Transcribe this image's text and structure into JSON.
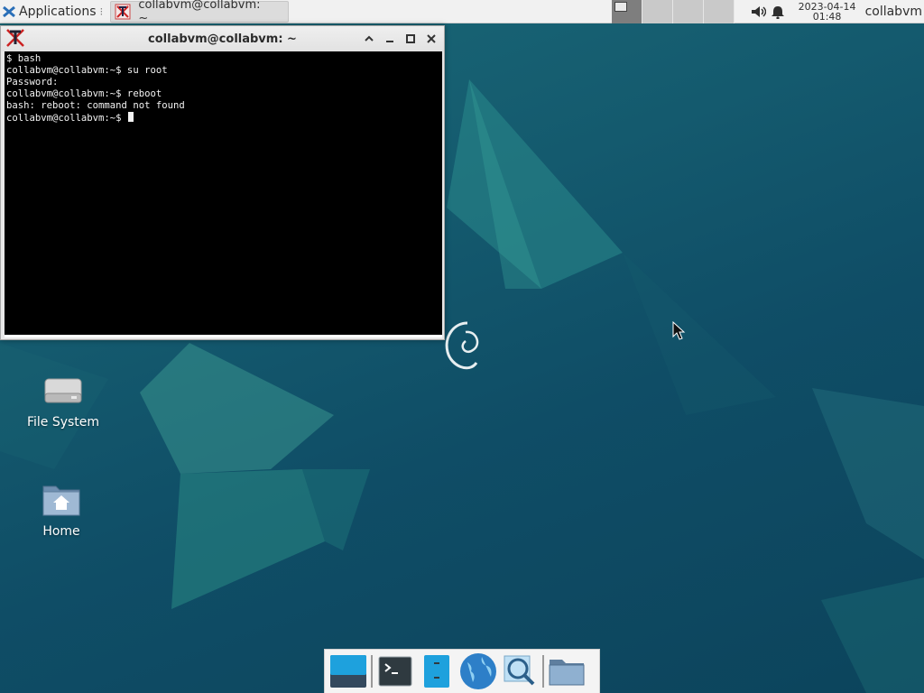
{
  "top_panel": {
    "applications_label": "Applications",
    "menu_separator": "⁝",
    "task_title": "collabvm@collabvm: ~",
    "clock_date": "2023-04-14",
    "clock_time": "01:48",
    "user_name": "collabvm",
    "icons": [
      "xfce-logo-icon",
      "terminal-app-icon",
      "volume-icon",
      "notification-bell-icon"
    ]
  },
  "terminal": {
    "title": "collabvm@collabvm: ~",
    "lines": [
      "$ bash",
      "collabvm@collabvm:~$ su root",
      "Password:",
      "collabvm@collabvm:~$ reboot",
      "bash: reboot: command not found"
    ],
    "prompt": "collabvm@collabvm:~$ ",
    "buttons": [
      "shade-icon",
      "minimize-icon",
      "maximize-icon",
      "close-icon"
    ]
  },
  "desktop": {
    "icons": [
      {
        "label": "File System",
        "icon": "drive-icon"
      },
      {
        "label": "Home",
        "icon": "home-folder-icon"
      }
    ]
  },
  "dock": {
    "items": [
      "show-desktop-icon",
      "terminal-icon",
      "file-manager-icon",
      "web-browser-icon",
      "app-finder-icon",
      "folder-icon"
    ]
  },
  "colors": {
    "desktop_base": "#15536a",
    "panel_bg": "#f1f1f1",
    "terminal_bg": "#000000",
    "terminal_fg": "#f2f2f2"
  }
}
